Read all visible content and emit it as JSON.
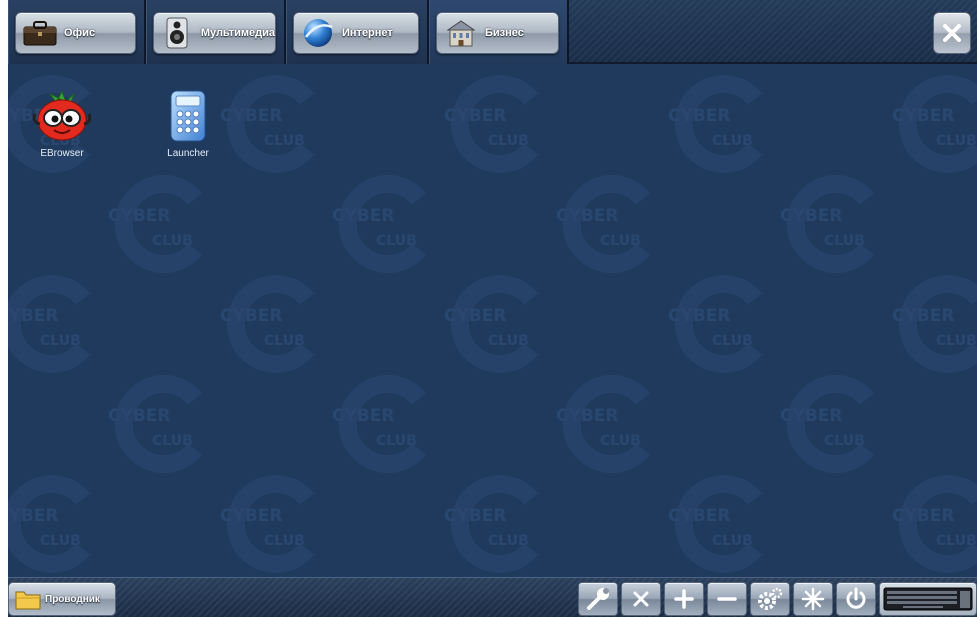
{
  "tabs": [
    {
      "label": "Офис",
      "icon": "briefcase-icon"
    },
    {
      "label": "Мультимедиа",
      "icon": "speaker-icon"
    },
    {
      "label": "Интернет",
      "icon": "globe-icon"
    },
    {
      "label": "Бизнес",
      "icon": "building-icon"
    }
  ],
  "close_icon": "close-icon",
  "desktop_icons": [
    {
      "label": "EBrowser",
      "icon": "tomato-mascot-icon"
    },
    {
      "label": "Launcher",
      "icon": "calculator-icon"
    }
  ],
  "watermark": {
    "text_top": "CYBER",
    "text_bottom": "CLUB"
  },
  "taskbar": {
    "explorer_label": "Проводник",
    "tools": [
      "wrench-icon",
      "close-x-icon",
      "plus-icon",
      "minus-icon",
      "gears-icon",
      "asterisk-icon",
      "power-icon",
      "keyboard-icon"
    ]
  },
  "colors": {
    "desktop": "#1f3a5d",
    "topbar": "#1f3351",
    "button_silver": "#aeb8c4"
  }
}
